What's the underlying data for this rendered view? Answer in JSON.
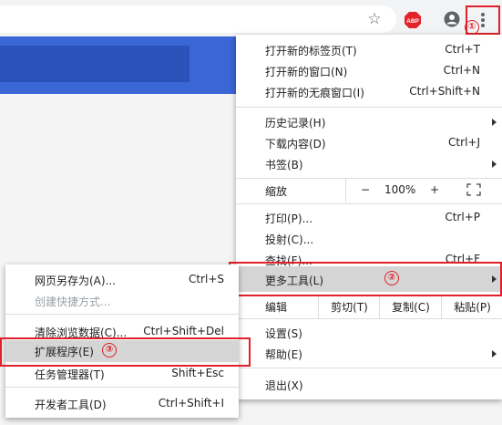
{
  "toolbar": {
    "star_icon": "star-icon",
    "abp_label": "ABP",
    "marker1": "①"
  },
  "colors": {
    "accent_red": "#e0202a",
    "banner_blue": "#3a66d6",
    "highlight": "#d5d5d5"
  },
  "menu": {
    "new_tab": {
      "label": "打开新的标签页(T)",
      "shortcut": "Ctrl+T"
    },
    "new_window": {
      "label": "打开新的窗口(N)",
      "shortcut": "Ctrl+N"
    },
    "new_incognito": {
      "label": "打开新的无痕窗口(I)",
      "shortcut": "Ctrl+Shift+N"
    },
    "history": {
      "label": "历史记录(H)"
    },
    "downloads": {
      "label": "下载内容(D)",
      "shortcut": "Ctrl+J"
    },
    "bookmarks": {
      "label": "书签(B)"
    },
    "zoom": {
      "label": "缩放",
      "minus": "−",
      "value": "100%",
      "plus": "+"
    },
    "print": {
      "label": "打印(P)...",
      "shortcut": "Ctrl+P"
    },
    "cast": {
      "label": "投射(C)..."
    },
    "find": {
      "label": "查找(F)...",
      "shortcut": "Ctrl+F"
    },
    "more_tools": {
      "label": "更多工具(L)",
      "marker": "②"
    },
    "edit": {
      "label": "编辑",
      "cut": "剪切(T)",
      "copy": "复制(C)",
      "paste": "粘贴(P)"
    },
    "settings": {
      "label": "设置(S)"
    },
    "help": {
      "label": "帮助(E)"
    },
    "exit": {
      "label": "退出(X)"
    }
  },
  "submenu": {
    "save_page": {
      "label": "网页另存为(A)...",
      "shortcut": "Ctrl+S"
    },
    "create_shortcut": {
      "label": "创建快捷方式..."
    },
    "clear_data": {
      "label": "清除浏览数据(C)...",
      "shortcut": "Ctrl+Shift+Del"
    },
    "extensions": {
      "label": "扩展程序(E)",
      "marker": "③"
    },
    "task_manager": {
      "label": "任务管理器(T)",
      "shortcut": "Shift+Esc"
    },
    "dev_tools": {
      "label": "开发者工具(D)",
      "shortcut": "Ctrl+Shift+I"
    }
  }
}
